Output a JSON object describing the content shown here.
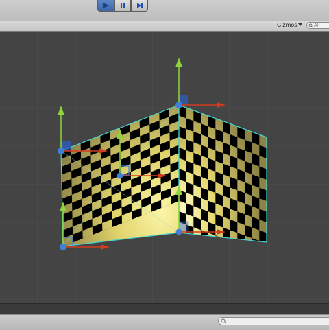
{
  "toolbar": {
    "play_icon": "play-icon",
    "pause_icon": "pause-icon",
    "step_icon": "step-icon",
    "accent": "#4a74b8"
  },
  "scene_view": {
    "gizmos_label": "Gizmos",
    "gizmos_dropdown_icon": "chevron-down-icon",
    "search_placeholder": "All",
    "search_icon": "search-icon"
  },
  "gizmo_colors": {
    "x_axis": "#d23c1e",
    "y_axis": "#8fd43a",
    "handle": "#3f7fd8",
    "outline": "#46d6cf"
  },
  "console": {
    "search_icon": "search-icon"
  }
}
